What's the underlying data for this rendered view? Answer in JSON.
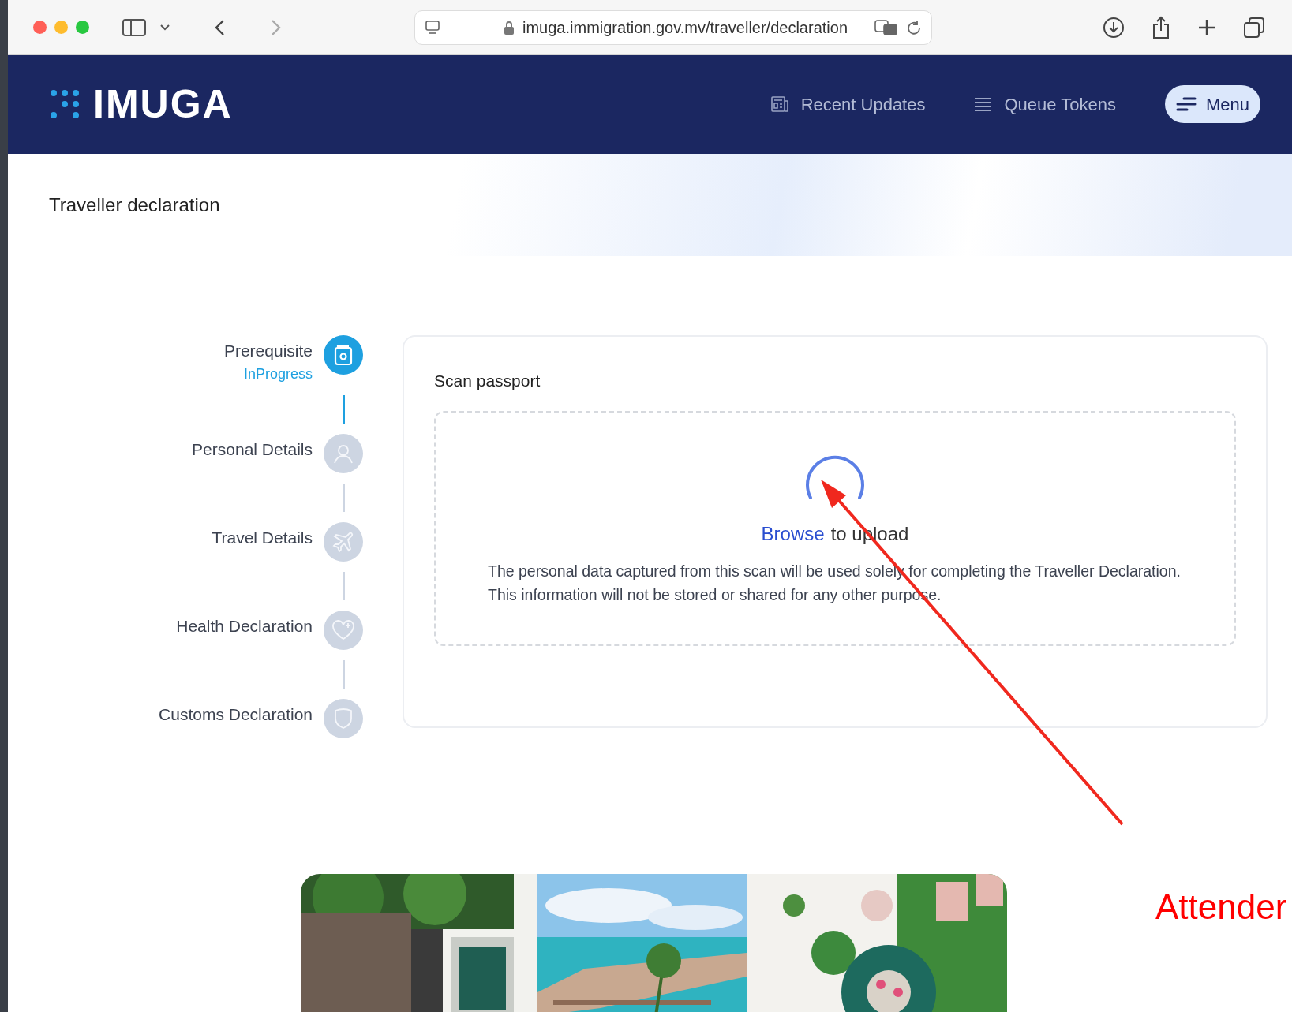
{
  "browser": {
    "url": "imuga.immigration.gov.mv/traveller/declaration"
  },
  "header": {
    "logo": "IMUGA",
    "nav": [
      {
        "label": "Recent Updates",
        "kind": "updates"
      },
      {
        "label": "Queue Tokens",
        "kind": "queue"
      }
    ],
    "menu_button": "Menu"
  },
  "page_title": "Traveller declaration",
  "steps": [
    {
      "label": "Prerequisite",
      "status": "InProgress",
      "selected": true,
      "kind": "passport"
    },
    {
      "label": "Personal Details",
      "selected": false,
      "kind": "person"
    },
    {
      "label": "Travel Details",
      "selected": false,
      "kind": "plane"
    },
    {
      "label": "Health Declaration",
      "selected": false,
      "kind": "heart"
    },
    {
      "label": "Customs Declaration",
      "selected": false,
      "kind": "shield"
    }
  ],
  "scan_card": {
    "title": "Scan passport",
    "browse_link": "Browse",
    "upload_text": "to upload",
    "note": "The personal data captured from this scan will be used solely for completing the Traveller Declaration. This information will not be stored or shared for any other purpose."
  },
  "annotation": {
    "text": "Attender"
  }
}
